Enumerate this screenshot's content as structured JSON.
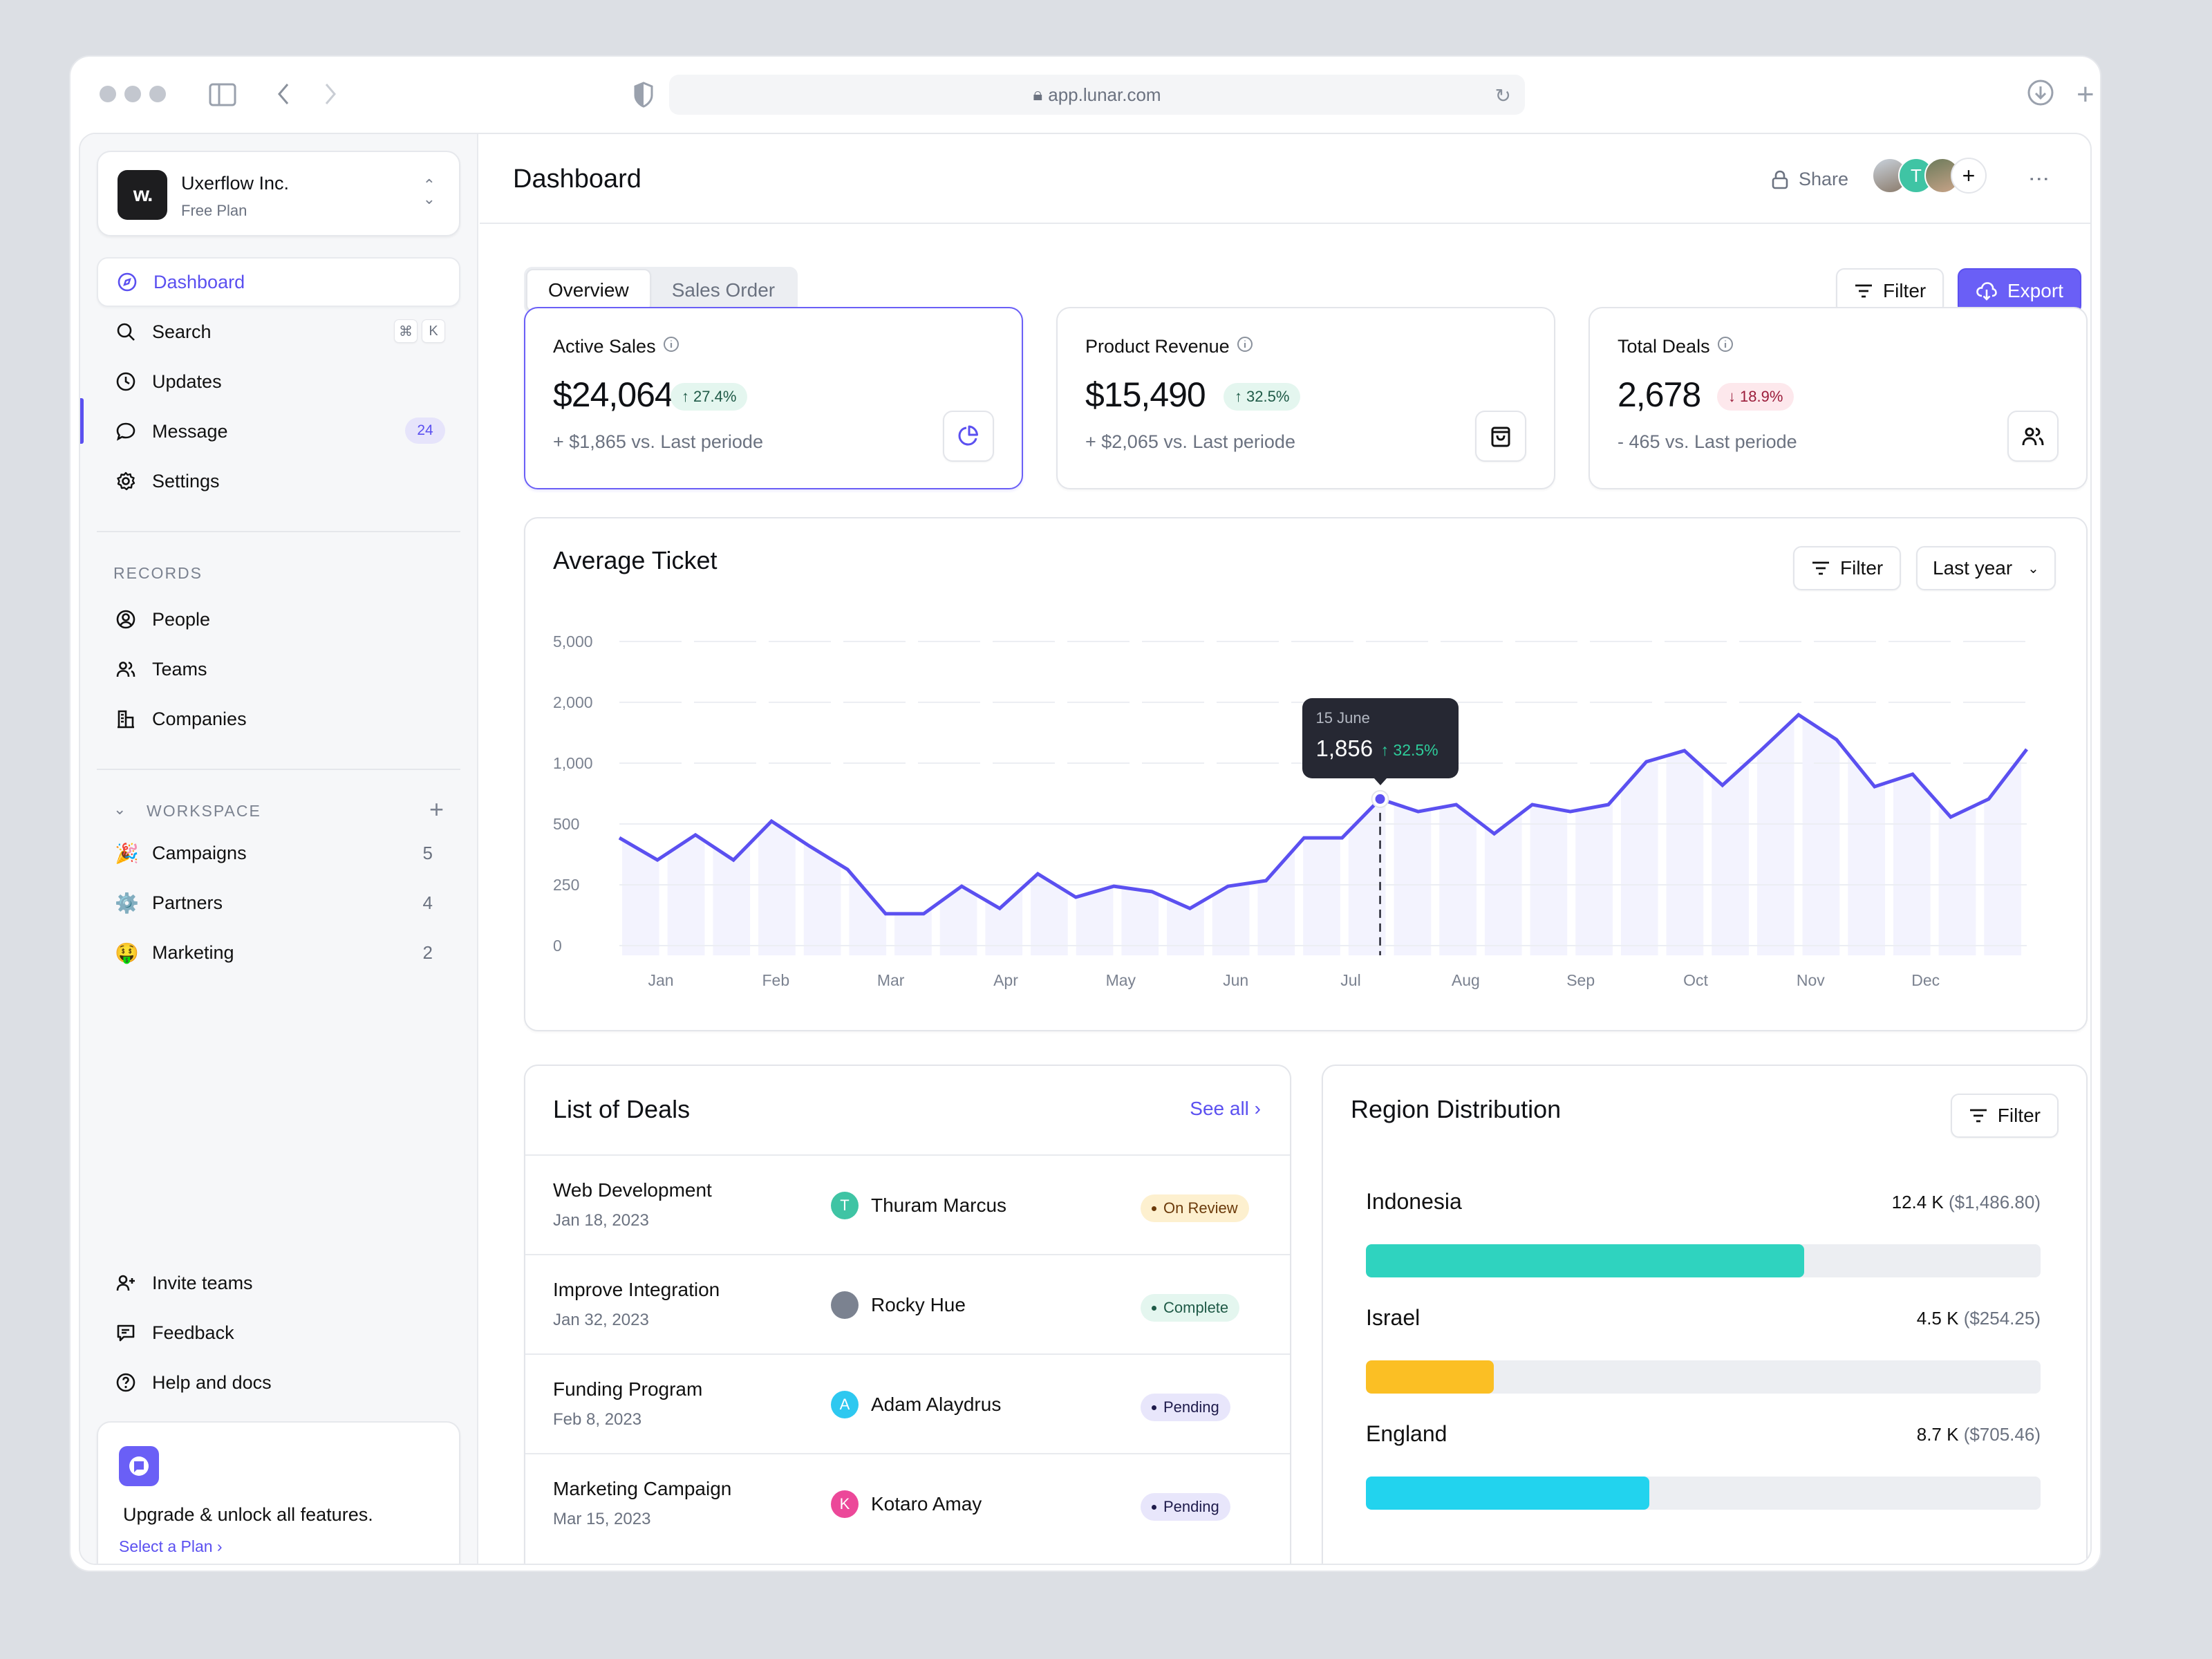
{
  "browser": {
    "url": "app.lunar.com"
  },
  "org": {
    "name": "Uxerflow Inc.",
    "plan": "Free Plan",
    "logo_text": "w."
  },
  "sidebar": {
    "main_items": [
      {
        "label": "Dashboard",
        "icon": "compass-icon",
        "active": true
      },
      {
        "label": "Search",
        "icon": "search-icon",
        "shortcut": [
          "⌘",
          "K"
        ]
      },
      {
        "label": "Updates",
        "icon": "clock-icon"
      },
      {
        "label": "Message",
        "icon": "message-icon",
        "badge": "24"
      },
      {
        "label": "Settings",
        "icon": "gear-icon"
      }
    ],
    "records_label": "RECORDS",
    "records": [
      {
        "label": "People",
        "icon": "user-circle-icon"
      },
      {
        "label": "Teams",
        "icon": "users-icon"
      },
      {
        "label": "Companies",
        "icon": "building-icon"
      }
    ],
    "workspace_label": "WORKSPACE",
    "workspace": [
      {
        "label": "Campaigns",
        "emoji": "🎉",
        "count": "5"
      },
      {
        "label": "Partners",
        "emoji": "⚙️",
        "count": "4"
      },
      {
        "label": "Marketing",
        "emoji": "🤑",
        "count": "2"
      }
    ],
    "bottom_items": [
      {
        "label": "Invite teams",
        "icon": "user-plus-icon"
      },
      {
        "label": "Feedback",
        "icon": "feedback-icon"
      },
      {
        "label": "Help and docs",
        "icon": "help-icon"
      }
    ],
    "upgrade": {
      "text": "Upgrade & unlock all features.",
      "link": "Select a Plan"
    }
  },
  "header": {
    "title": "Dashboard",
    "share_label": "Share",
    "avatars": [
      {
        "type": "photo",
        "color": "#9aa6b4"
      },
      {
        "type": "initial",
        "initial": "T",
        "color": "#3fc4a4"
      },
      {
        "type": "photo",
        "color": "#7d6a55"
      }
    ]
  },
  "tabs": [
    {
      "label": "Overview",
      "active": true
    },
    {
      "label": "Sales Order",
      "active": false
    }
  ],
  "toolbar": {
    "filter_label": "Filter",
    "export_label": "Export"
  },
  "kpis": [
    {
      "label": "Active Sales",
      "value": "$24,064",
      "change": "27.4%",
      "direction": "up",
      "sub": "+ $1,865 vs. Last periode",
      "icon": "pie-chart-icon",
      "selected": true
    },
    {
      "label": "Product Revenue",
      "value": "$15,490",
      "change": "32.5%",
      "direction": "up",
      "sub": "+ $2,065 vs. Last periode",
      "icon": "shopping-bag-icon",
      "selected": false
    },
    {
      "label": "Total Deals",
      "value": "2,678",
      "change": "18.9%",
      "direction": "down",
      "sub": "- 465 vs. Last periode",
      "icon": "users-icon",
      "selected": false
    }
  ],
  "chart_card": {
    "title": "Average Ticket",
    "filter_label": "Filter",
    "range_label": "Last year",
    "tooltip": {
      "date": "15 June",
      "value": "1,856",
      "change": "32.5%"
    }
  },
  "chart_data": {
    "type": "line",
    "title": "Average Ticket",
    "xlabel": "",
    "ylabel": "",
    "y_ticks": [
      0,
      250,
      500,
      1000,
      2000,
      5000
    ],
    "y_tick_labels": [
      "0",
      "250",
      "500",
      "1,000",
      "2,000",
      "5,000"
    ],
    "y_scale": "piecewise (equal spacing between ticks)",
    "x_tick_labels": [
      "Jan",
      "Feb",
      "Mar",
      "Apr",
      "May",
      "Jun",
      "Jul",
      "Aug",
      "Sep",
      "Oct",
      "Nov",
      "Dec"
    ],
    "grid": true,
    "series": [
      {
        "name": "Average Ticket",
        "color": "#5b50f0",
        "values": [
          443,
          352,
          455,
          352,
          523,
          409,
          313,
          131,
          131,
          244,
          153,
          295,
          199,
          244,
          222,
          153,
          244,
          267,
          443,
          443,
          705,
          602,
          659,
          460,
          659,
          602,
          659,
          1023,
          1205,
          818,
          1205,
          1795,
          1386,
          807,
          909,
          557,
          705,
          1227
        ]
      }
    ],
    "highlight": {
      "index": 20,
      "label": "15 June",
      "value": 1856,
      "change": "32.5%"
    }
  },
  "deals": {
    "title": "List of Deals",
    "see_all": "See all",
    "rows": [
      {
        "name": "Web Development",
        "date": "Jan 18, 2023",
        "owner": "Thuram Marcus",
        "initial": "T",
        "avatar_color": "#3fc4a4",
        "status": "On Review",
        "status_kind": "review"
      },
      {
        "name": "Improve Integration",
        "date": "Jan 32, 2023",
        "owner": "Rocky Hue",
        "initial": "",
        "avatar_color": "#7b8290",
        "status": "Complete",
        "status_kind": "complete"
      },
      {
        "name": "Funding Program",
        "date": "Feb 8, 2023",
        "owner": "Adam Alaydrus",
        "initial": "A",
        "avatar_color": "#2ec8f0",
        "status": "Pending",
        "status_kind": "pending"
      },
      {
        "name": "Marketing Campaign",
        "date": "Mar 15, 2023",
        "owner": "Kotaro Amay",
        "initial": "K",
        "avatar_color": "#ec4899",
        "status": "Pending",
        "status_kind": "pending"
      }
    ]
  },
  "regions": {
    "title": "Region Distribution",
    "filter_label": "Filter",
    "items": [
      {
        "name": "Indonesia",
        "count": "12.4 K",
        "amount": "($1,486.80)",
        "fraction": 0.65,
        "color": "#2fd3bf"
      },
      {
        "name": "Israel",
        "count": "4.5 K",
        "amount": "($254.25)",
        "fraction": 0.19,
        "color": "#fbbf24"
      },
      {
        "name": "England",
        "count": "8.7 K",
        "amount": "($705.46)",
        "fraction": 0.42,
        "color": "#22d3ee"
      }
    ]
  }
}
